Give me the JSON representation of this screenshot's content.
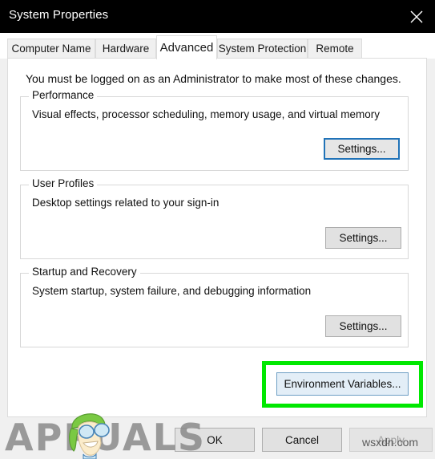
{
  "window": {
    "title": "System Properties",
    "close_icon": "close-icon"
  },
  "tabs": [
    {
      "label": "Computer Name",
      "active": false
    },
    {
      "label": "Hardware",
      "active": false
    },
    {
      "label": "Advanced",
      "active": true
    },
    {
      "label": "System Protection",
      "active": false
    },
    {
      "label": "Remote",
      "active": false
    }
  ],
  "content": {
    "admin_note": "You must be logged on as an Administrator to make most of these changes.",
    "groups": [
      {
        "title": "Performance",
        "description": "Visual effects, processor scheduling, memory usage, and virtual memory",
        "button_label": "Settings..."
      },
      {
        "title": "User Profiles",
        "description": "Desktop settings related to your sign-in",
        "button_label": "Settings..."
      },
      {
        "title": "Startup and Recovery",
        "description": "System startup, system failure, and debugging information",
        "button_label": "Settings..."
      }
    ],
    "environment_variables_label": "Environment Variables..."
  },
  "footer": {
    "ok_label": "OK",
    "cancel_label": "Cancel",
    "apply_label": "Apply"
  },
  "watermarks": {
    "appuals": "APPUALS",
    "wsxdn": "wsxdn.com"
  },
  "colors": {
    "titlebar_background": "#000000",
    "titlebar_text": "#ffffff",
    "window_background": "#f0f0f0",
    "panel_background": "#ffffff",
    "annotation_green": "#00e800",
    "focus_blue": "#2173b8",
    "highlight_button_fill": "#e3eef7",
    "button_face": "#e1e1e1",
    "disabled_text": "#a0a0a0"
  }
}
